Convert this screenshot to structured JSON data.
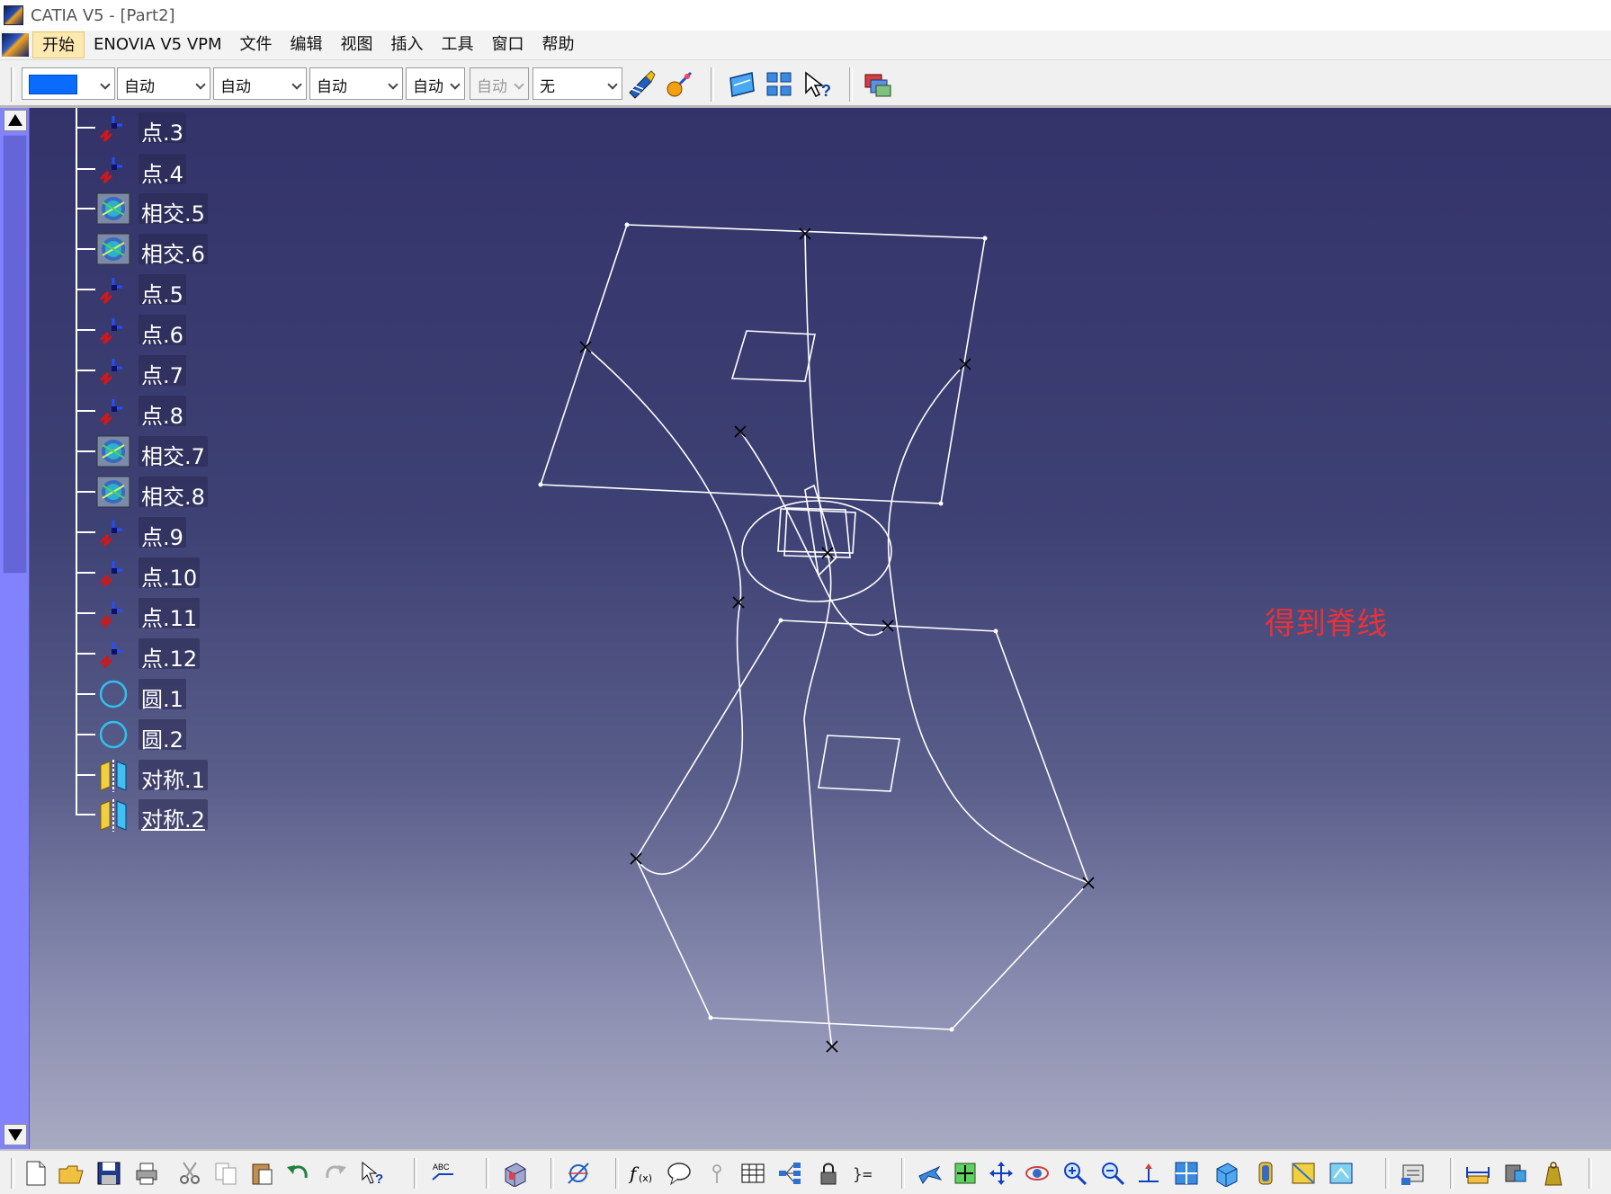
{
  "window": {
    "title": "CATIA V5 - [Part2]"
  },
  "menu": {
    "items": [
      "开始",
      "ENOVIA V5 VPM",
      "文件",
      "编辑",
      "视图",
      "插入",
      "工具",
      "窗口",
      "帮助"
    ]
  },
  "toolbar": {
    "color_value": "",
    "combos": [
      "自动",
      "自动",
      "自动",
      "自动",
      "自动",
      "无"
    ],
    "icons": [
      "painter-brush-icon",
      "magic-wand-icon",
      "plane-icon",
      "array-icon",
      "what-is-this-icon",
      "multi-document-icon"
    ]
  },
  "tree": {
    "items": [
      {
        "label": "点.3",
        "icon": "point-icon"
      },
      {
        "label": "点.4",
        "icon": "point-icon"
      },
      {
        "label": "相交.5",
        "icon": "intersection-icon"
      },
      {
        "label": "相交.6",
        "icon": "intersection-icon"
      },
      {
        "label": "点.5",
        "icon": "point-icon"
      },
      {
        "label": "点.6",
        "icon": "point-icon"
      },
      {
        "label": "点.7",
        "icon": "point-icon"
      },
      {
        "label": "点.8",
        "icon": "point-icon"
      },
      {
        "label": "相交.7",
        "icon": "intersection-icon"
      },
      {
        "label": "相交.8",
        "icon": "intersection-icon"
      },
      {
        "label": "点.9",
        "icon": "point-icon"
      },
      {
        "label": "点.10",
        "icon": "point-icon"
      },
      {
        "label": "点.11",
        "icon": "point-icon"
      },
      {
        "label": "点.12",
        "icon": "point-icon"
      },
      {
        "label": "圆.1",
        "icon": "circle-icon"
      },
      {
        "label": "圆.2",
        "icon": "circle-icon"
      },
      {
        "label": "对称.1",
        "icon": "symmetry-icon"
      },
      {
        "label": "对称.2",
        "icon": "symmetry-icon"
      }
    ]
  },
  "annotation": {
    "text": "得到脊线"
  },
  "colors": {
    "accent": "#0a6cff",
    "annotation": "#e8323a",
    "wireframe": "#ffffff"
  }
}
